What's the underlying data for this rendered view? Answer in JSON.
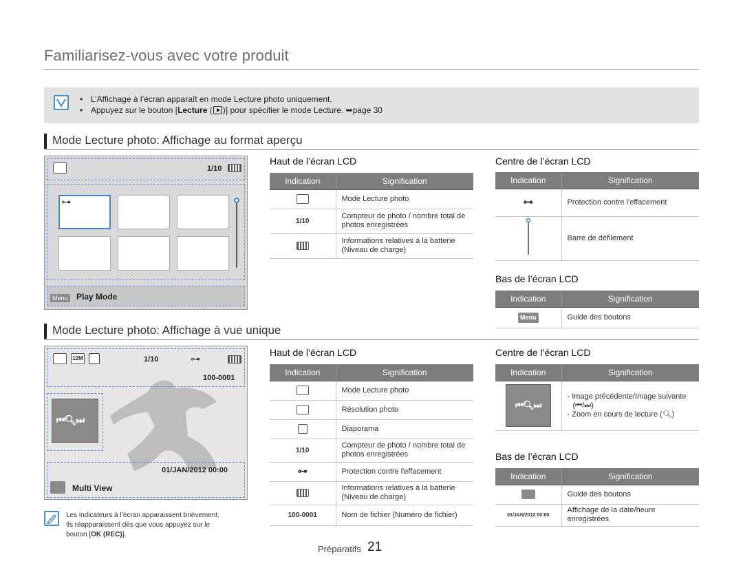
{
  "page": {
    "title": "Familiarisez-vous avec votre produit",
    "footer_label": "Préparatifs",
    "footer_page": "21"
  },
  "note": {
    "line1": "L’Affichage à l’écran apparaît en mode Lecture photo uniquement.",
    "line2_pre": "Appuyez sur le bouton [",
    "line2_bold": "Lecture",
    "line2_post": "] pour spécifier le mode Lecture. ➥page 30"
  },
  "section1": {
    "title": "Mode Lecture photo: Affichage au format aperçu",
    "screen": {
      "counter": "1/10",
      "menu_chip": "Menu",
      "bottom_label": "Play Mode"
    },
    "top_lcd": {
      "heading": "Haut de l’écran LCD",
      "col_indication": "Indication",
      "col_signification": "Signification",
      "rows": [
        {
          "indication": "",
          "icon": "photo-playback-icon",
          "signification": "Mode Lecture photo"
        },
        {
          "indication": "1/10",
          "signification": "Compteur de photo / nombre total de photos enregistrées"
        },
        {
          "indication": "",
          "icon": "battery-icon",
          "signification": "Informations relatives à la batterie (Niveau de charge)"
        }
      ]
    },
    "center_lcd": {
      "heading": "Centre de l’écran LCD",
      "col_indication": "Indication",
      "col_signification": "Signification",
      "rows": [
        {
          "icon": "protect-key-icon",
          "signification": "Protection contre l'effacement"
        },
        {
          "icon": "scroll-bar-icon",
          "signification": "Barre de défilement"
        }
      ]
    },
    "bottom_lcd": {
      "heading": "Bas de l’écran LCD",
      "col_indication": "Indication",
      "col_signification": "Signification",
      "rows": [
        {
          "indication": "Menu",
          "signification": "Guide des boutons"
        }
      ]
    }
  },
  "section2": {
    "title": "Mode Lecture photo: Affichage à vue unique",
    "screen": {
      "counter": "1/10",
      "filename": "100-0001",
      "datetime": "01/JAN/2012 00:00",
      "bottom_label": "Multi View",
      "resolution": "12M"
    },
    "top_lcd": {
      "heading": "Haut de l’écran LCD",
      "col_indication": "Indication",
      "col_signification": "Signification",
      "rows": [
        {
          "icon": "photo-playback-icon",
          "signification": "Mode Lecture photo"
        },
        {
          "icon": "resolution-icon",
          "signification": "Résolution photo"
        },
        {
          "icon": "slideshow-icon",
          "signification": "Diaporama"
        },
        {
          "indication": "1/10",
          "signification": "Compteur de photo / nombre total de photos enregistrées"
        },
        {
          "icon": "protect-key-icon",
          "signification": "Protection contre l'effacement"
        },
        {
          "icon": "battery-icon",
          "signification": "Informations relatives à la batterie (Niveau de charge)"
        },
        {
          "indication": "100-0001",
          "signification": "Nom de fichier (Numéro de fichier)"
        }
      ]
    },
    "center_lcd": {
      "heading": "Centre de l’écran LCD",
      "col_indication": "Indication",
      "col_signification": "Signification",
      "line1": "- Image précédente/Image suivante",
      "line2": "(⏮/⏭)",
      "line3": "- Zoom en cours de lecture"
    },
    "bottom_lcd": {
      "heading": "Bas de l’écran LCD",
      "col_indication": "Indication",
      "col_signification": "Signification",
      "rows": [
        {
          "icon": "button-guide-icon",
          "signification": "Guide des boutons"
        },
        {
          "indication": "01/JAN/2012 00:00",
          "signification": "Affichage de la date/heure enregistrées"
        }
      ]
    },
    "memo": {
      "line1": "Les indicateurs à l’écran apparaissent brièvement.",
      "line2": "Ils réapparaissent dès que vous appuyez sur le",
      "line3_pre": "bouton [",
      "line3_bold": "OK (REC)",
      "line3_post": "]."
    }
  }
}
